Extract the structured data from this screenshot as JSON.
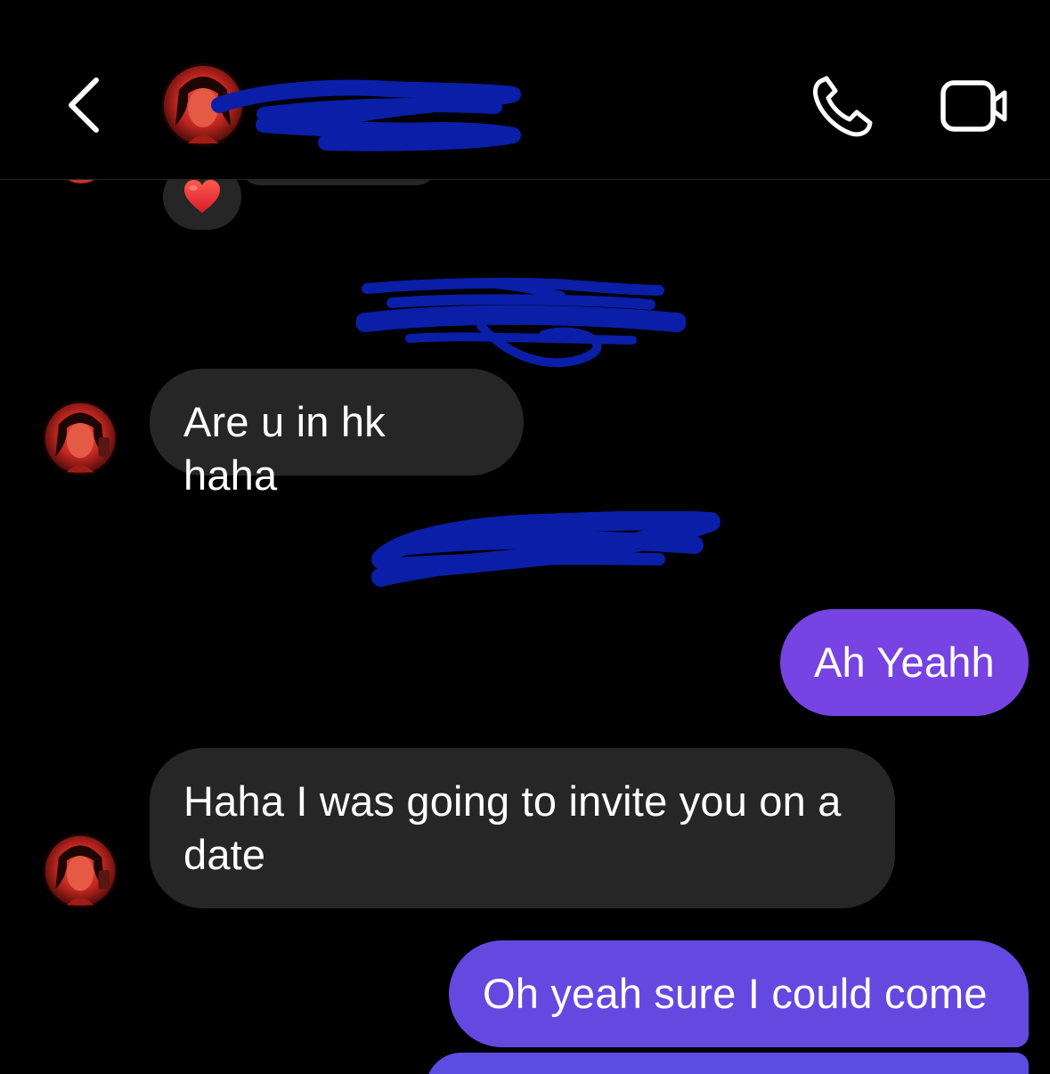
{
  "header": {
    "back_icon": "chevron-left-icon",
    "call_icon": "phone-icon",
    "video_icon": "video-camera-icon"
  },
  "messages": [
    {
      "from": "them",
      "text": "Are u in hk haha"
    },
    {
      "from": "me",
      "text": "Ah Yeahh"
    },
    {
      "from": "them",
      "text": "Haha I was going to invite you on a date"
    },
    {
      "from": "me",
      "text": "Oh yeah sure I could come"
    }
  ],
  "reaction": {
    "emoji": "❤️"
  },
  "colors": {
    "background": "#000000",
    "incoming_bubble": "#262626",
    "outgoing_bubble_top": "#7a3fe0",
    "outgoing_bubble_bottom": "#5d4ee0",
    "redaction": "#0a1ea8"
  }
}
